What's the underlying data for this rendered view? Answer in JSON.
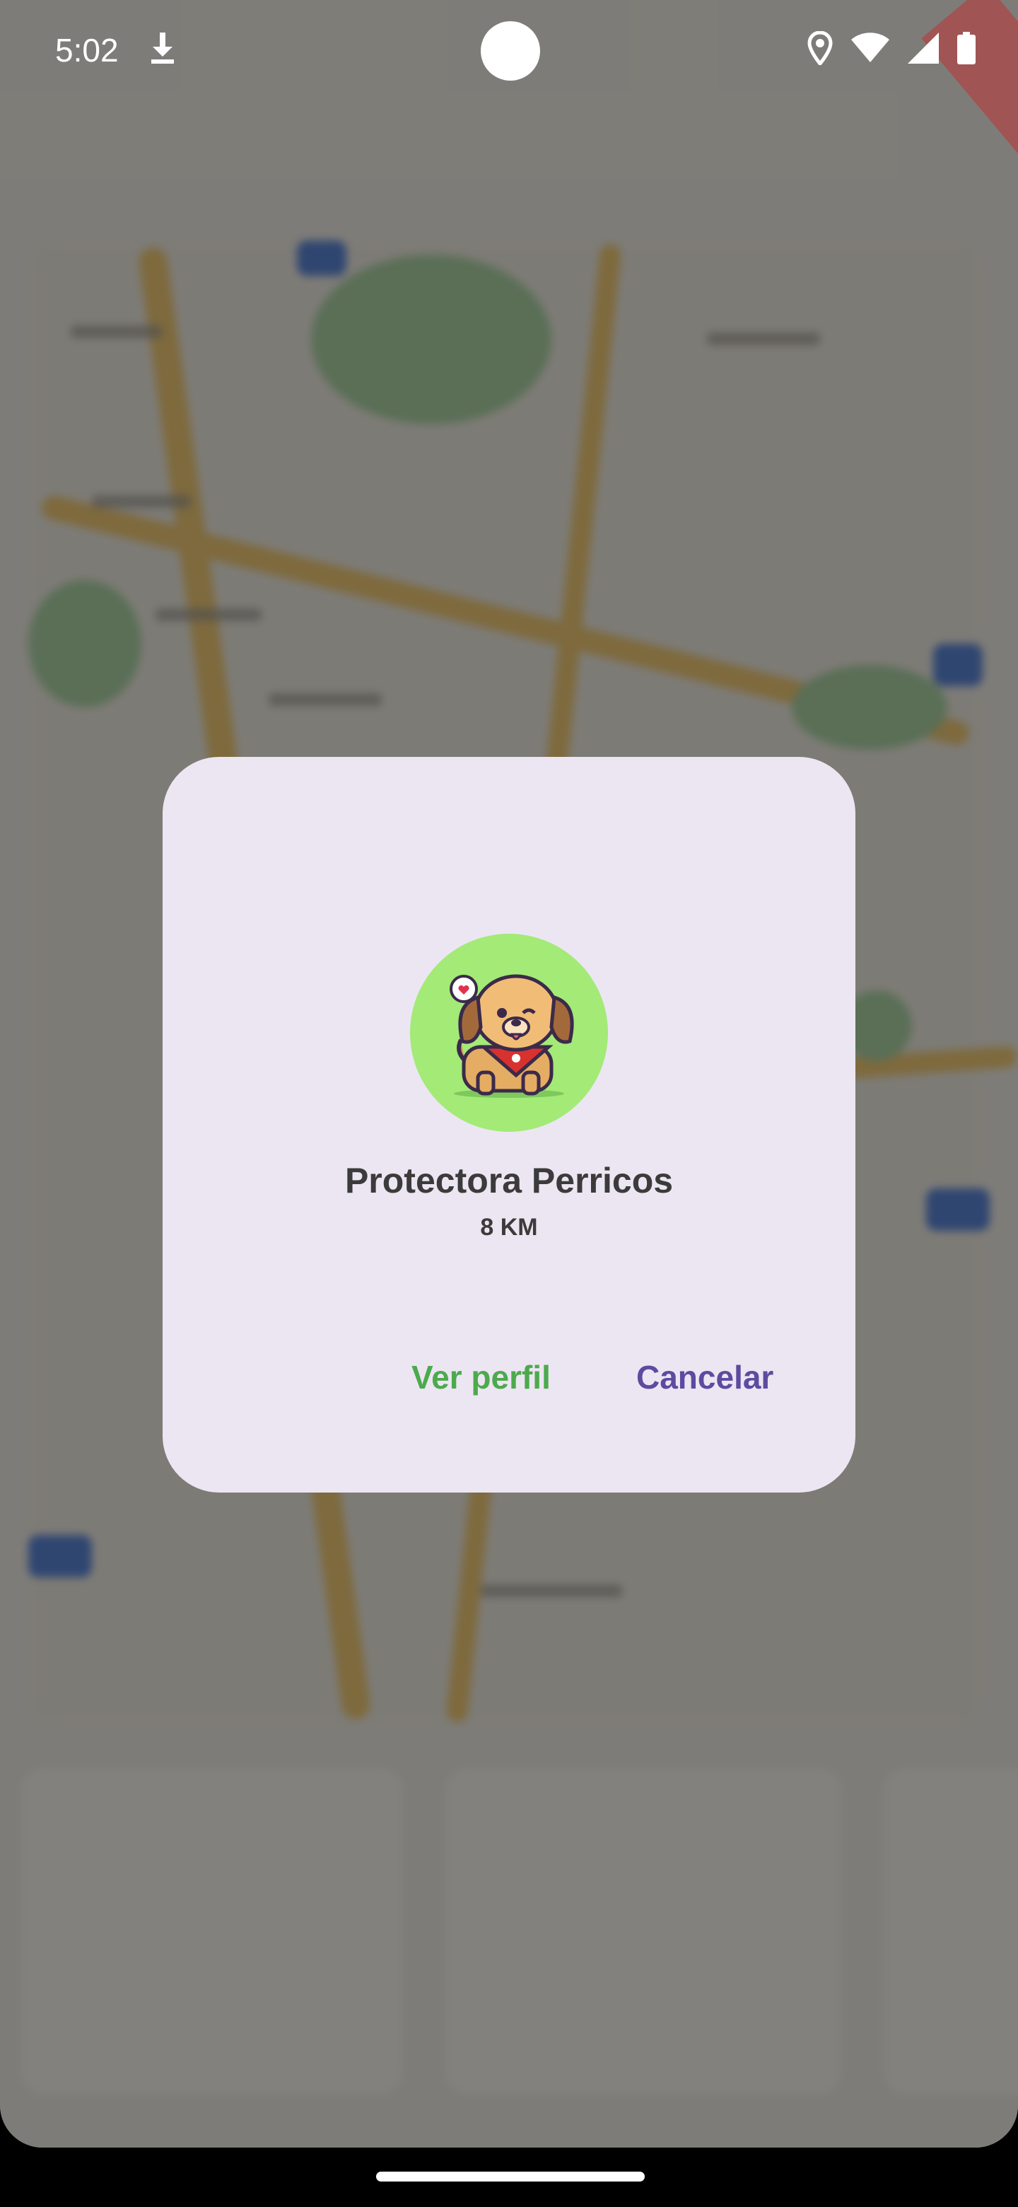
{
  "status_bar": {
    "time": "5:02",
    "icons": [
      "download-icon",
      "location-icon",
      "wifi-icon",
      "signal-icon",
      "battery-icon"
    ]
  },
  "dialog": {
    "title": "Protectora Perricos",
    "distance": "8 KM",
    "primary_button": "Ver perfil",
    "secondary_button": "Cancelar",
    "avatar_icon": "dog-icon"
  },
  "colors": {
    "dialog_bg": "#ece6f2",
    "avatar_bg": "#a3ea77",
    "primary_button": "#4caa4c",
    "secondary_button": "#5e4aa0"
  }
}
